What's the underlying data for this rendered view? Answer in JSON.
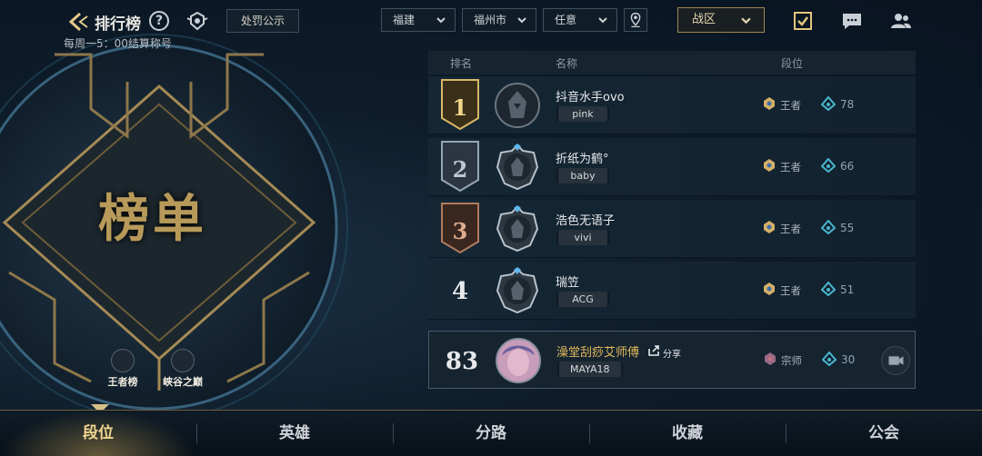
{
  "header": {
    "title": "排行榜",
    "help_icon": "?",
    "penalty_label": "处罚公示",
    "subtitle": "每周一5：00结算称号"
  },
  "filters": {
    "province": "福建",
    "city": "福州市",
    "any": "任意",
    "zone": "战区"
  },
  "board": {
    "title": "榜单",
    "mini_left": "王者榜",
    "mini_right": "峡谷之巅"
  },
  "table": {
    "col_rank": "排名",
    "col_name": "名称",
    "col_tier": "段位",
    "rows": [
      {
        "rank": "1",
        "name": "抖音水手ovo",
        "tag": "pink",
        "tier": "王者",
        "stars": "78"
      },
      {
        "rank": "2",
        "name": "折纸为鹤°",
        "tag": "baby",
        "tier": "王者",
        "stars": "66"
      },
      {
        "rank": "3",
        "name": "浩色无语子",
        "tag": "vivi",
        "tier": "王者",
        "stars": "55"
      },
      {
        "rank": "4",
        "name": "瑞笠",
        "tag": "ACG",
        "tier": "王者",
        "stars": "51"
      }
    ],
    "me": {
      "rank": "83",
      "name": "澡堂刮痧艾师傅",
      "share": "分享",
      "tag": "MAYA18",
      "tier": "宗师",
      "stars": "30"
    }
  },
  "tabs": [
    "段位",
    "英雄",
    "分路",
    "收藏",
    "公会"
  ],
  "colors": {
    "gold": "#b79a5a",
    "active_tab": "#f0d692",
    "bg": "#0b1622"
  }
}
